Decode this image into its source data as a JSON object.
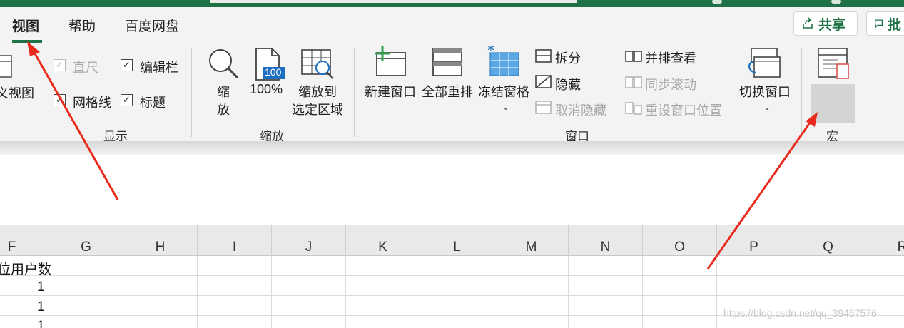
{
  "tabs": [
    {
      "label": "视图",
      "active": true
    },
    {
      "label": "帮助",
      "active": false
    },
    {
      "label": "百度网盘",
      "active": false
    }
  ],
  "top_buttons": {
    "share": "共享",
    "comment_partial": "批"
  },
  "ribbon": {
    "views": {
      "partial_label": "义视图"
    },
    "show": {
      "group_label": "显示",
      "ruler": {
        "label": "直尺",
        "checked": true,
        "enabled": false
      },
      "formula_bar": {
        "label": "编辑栏",
        "checked": true,
        "enabled": true
      },
      "gridlines": {
        "label": "网格线",
        "checked": true,
        "enabled": true
      },
      "headings": {
        "label": "标题",
        "checked": true,
        "enabled": true
      }
    },
    "zoom": {
      "group_label": "缩放",
      "zoom_label_1": "缩",
      "zoom_label_2": "放",
      "hundred_label": "100%",
      "hundred_icon_text": "100",
      "zoom_sel_label_1": "缩放到",
      "zoom_sel_label_2": "选定区域"
    },
    "window": {
      "group_label": "窗口",
      "new_window": "新建窗口",
      "arrange_all": "全部重排",
      "freeze_panes": "冻结窗格",
      "split": "拆分",
      "hide": "隐藏",
      "unhide": "取消隐藏",
      "side_by_side": "并排查看",
      "sync_scroll": "同步滚动",
      "reset_position": "重设窗口位置",
      "switch_windows": "切换窗口"
    },
    "macros": {
      "group_label": "宏",
      "button_label": "宏"
    }
  },
  "columns": [
    "F",
    "G",
    "H",
    "I",
    "J",
    "K",
    "L",
    "M",
    "N",
    "O",
    "P",
    "Q",
    "R"
  ],
  "cells": {
    "f_header": "位用户数",
    "rows": [
      "1",
      "1",
      "1"
    ]
  },
  "watermark": "https://blog.csdn.net/qq_39467576",
  "colors": {
    "accent": "#1f7245",
    "arrow": "#e8291c",
    "ribbon_bg": "#f3f3f3"
  }
}
